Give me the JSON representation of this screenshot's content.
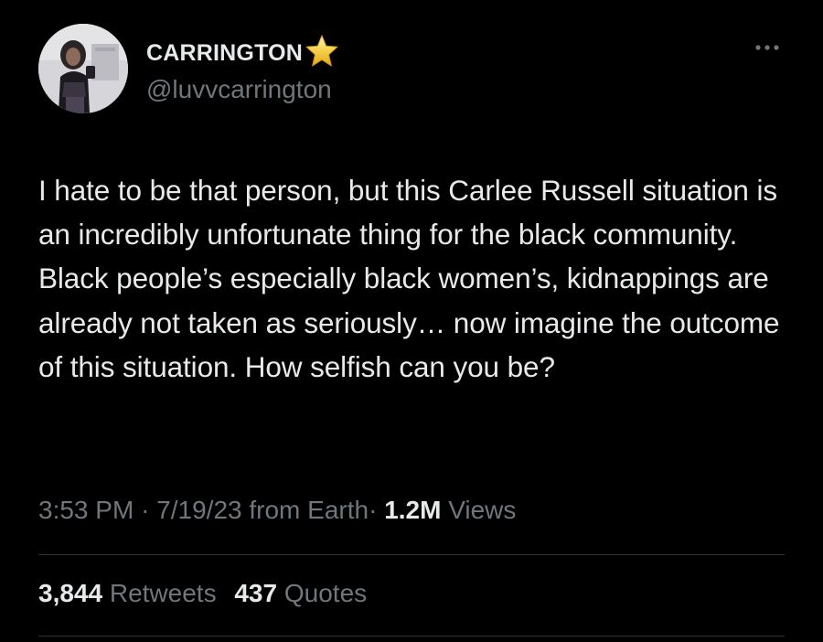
{
  "author": {
    "display_name": "CARRINGTON",
    "badge_icon": "star-icon",
    "badge_color": "#f5d04a",
    "handle": "@luvvcarrington"
  },
  "tweet": {
    "text": "I hate to be that person, but this Carlee Russell situation is an incredibly unfortunate thing for the black community. Black people’s especially black women’s, kidnappings are already not taken as seriously… now imagine the outcome of this situation. How selfish can you be?"
  },
  "meta": {
    "time": "3:53 PM",
    "separator1": "·",
    "date": "7/19/23",
    "source": "from Earth",
    "separator2": "·",
    "views_count": "1.2M",
    "views_label": "Views"
  },
  "stats": {
    "retweets_count": "3,844",
    "retweets_label": "Retweets",
    "quotes_count": "437",
    "quotes_label": "Quotes"
  },
  "colors": {
    "background": "#000000",
    "primary_text": "#e7e9ea",
    "secondary_text": "#71767b",
    "divider": "#2f3336"
  }
}
